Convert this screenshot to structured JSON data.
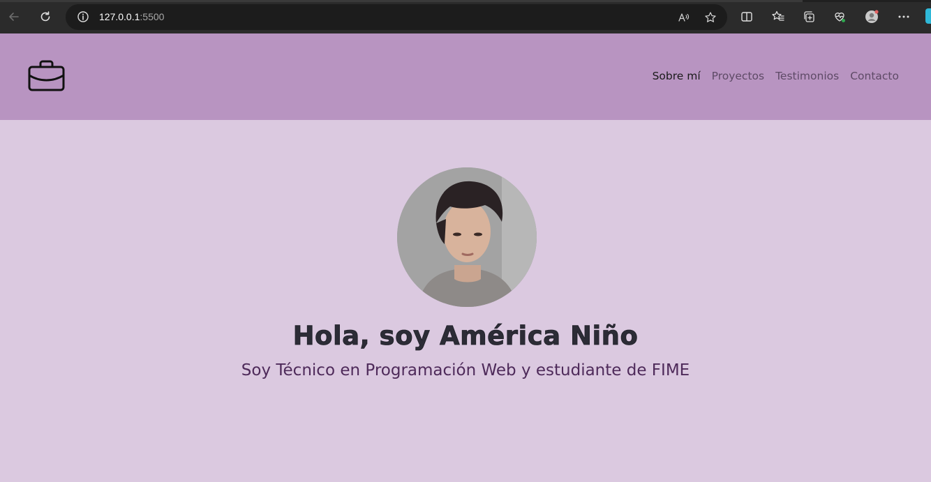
{
  "browser": {
    "url_host": "127.0.0.1",
    "url_port": ":5500",
    "icons": [
      "back-arrow-icon",
      "refresh-icon",
      "info-icon",
      "read-aloud-icon",
      "favorite-star-icon",
      "split-screen-icon",
      "favorites-icon",
      "collections-icon",
      "browser-essentials-icon",
      "profile-icon",
      "more-icon"
    ]
  },
  "header": {
    "logo_icon": "briefcase-icon",
    "nav": [
      {
        "label": "Sobre mí",
        "active": true
      },
      {
        "label": "Proyectos",
        "active": false
      },
      {
        "label": "Testimonios",
        "active": false
      },
      {
        "label": "Contacto",
        "active": false
      }
    ],
    "background": "#b894c1"
  },
  "hero": {
    "title": "Hola, soy América Niño",
    "subtitle": "Soy Técnico en Programación Web y estudiante de FIME",
    "background": "#dbc9e0",
    "subtitle_color": "#4e2a5a"
  }
}
